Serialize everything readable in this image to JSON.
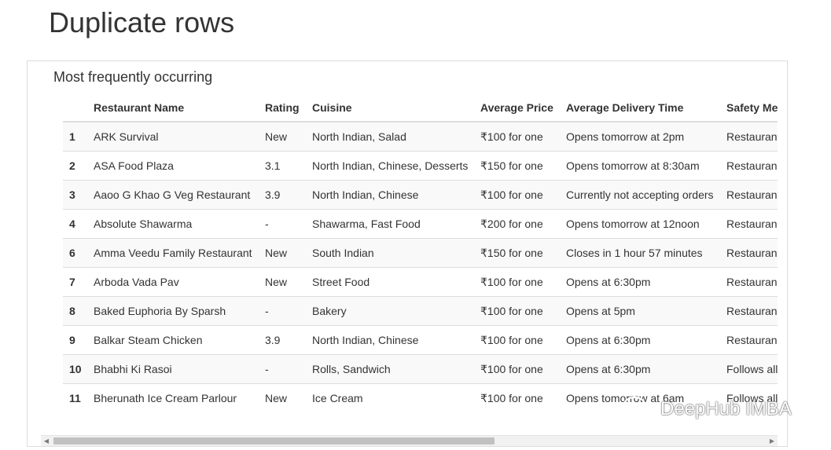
{
  "page": {
    "title": "Duplicate rows"
  },
  "panel": {
    "subtitle": "Most frequently occurring"
  },
  "table": {
    "columns": [
      "",
      "Restaurant Name",
      "Rating",
      "Cuisine",
      "Average Price",
      "Average Delivery Time",
      "Safety Me"
    ],
    "rows": [
      [
        "1",
        "ARK Survival",
        "New",
        "North Indian, Salad",
        "₹100 for one",
        "Opens tomorrow at 2pm",
        "Restaurant"
      ],
      [
        "2",
        "ASA Food Plaza",
        "3.1",
        "North Indian, Chinese, Desserts",
        "₹150 for one",
        "Opens tomorrow at 8:30am",
        "Restaurant"
      ],
      [
        "3",
        "Aaoo G Khao G Veg Restaurant",
        "3.9",
        "North Indian, Chinese",
        "₹100 for one",
        "Currently not accepting orders",
        "Restaurant"
      ],
      [
        "4",
        "Absolute Shawarma",
        "-",
        "Shawarma, Fast Food",
        "₹200 for one",
        "Opens tomorrow at 12noon",
        "Restaurant"
      ],
      [
        "6",
        "Amma Veedu Family Restaurant",
        "New",
        "South Indian",
        "₹150 for one",
        "Closes in 1 hour 57 minutes",
        "Restaurant"
      ],
      [
        "7",
        "Arboda Vada Pav",
        "New",
        "Street Food",
        "₹100 for one",
        "Opens at 6:30pm",
        "Restaurant"
      ],
      [
        "8",
        "Baked Euphoria By Sparsh",
        "-",
        "Bakery",
        "₹100 for one",
        "Opens at 5pm",
        "Restaurant"
      ],
      [
        "9",
        "Balkar Steam Chicken",
        "3.9",
        "North Indian, Chinese",
        "₹100 for one",
        "Opens at 6:30pm",
        "Restaurant"
      ],
      [
        "10",
        "Bhabhi Ki Rasoi",
        "-",
        "Rolls, Sandwich",
        "₹100 for one",
        "Opens at 6:30pm",
        "Follows all"
      ],
      [
        "11",
        "Bherunath Ice Cream Parlour",
        "New",
        "Ice Cream",
        "₹100 for one",
        "Opens tomorrow at 6am",
        "Follows all"
      ]
    ]
  },
  "scrollbar": {
    "left_arrow": "◀",
    "right_arrow": "▶",
    "position_fraction": 0.0,
    "visible_fraction": 0.62
  },
  "watermark": {
    "text": "DeepHub IMBA",
    "icon": "wechat-icon"
  }
}
